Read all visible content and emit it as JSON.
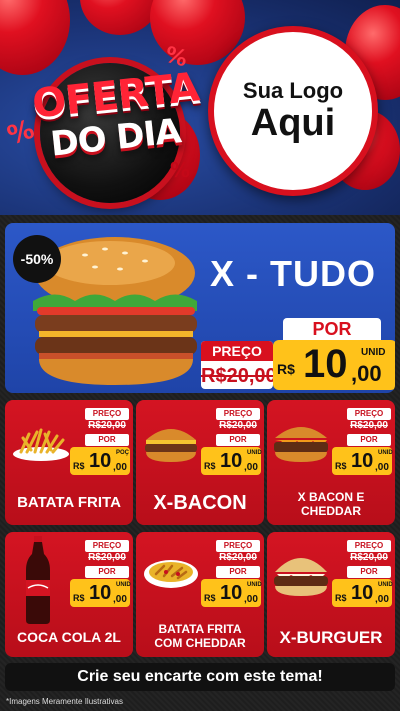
{
  "header": {
    "badge_line1": "OFERTA",
    "badge_line2": "DO DIA",
    "percent_symbol": "%",
    "logo_line1": "Sua Logo",
    "logo_line2": "Aqui"
  },
  "featured": {
    "discount": "-50%",
    "title": "X - TUDO",
    "old_label": "PREÇO",
    "old_price": "R$20,00",
    "new_label": "POR",
    "currency": "R$",
    "price_int": "10",
    "price_dec": ",00",
    "unit": "UNID"
  },
  "products": [
    {
      "name": "BATATA FRITA",
      "old_label": "PREÇO",
      "old_price": "R$20,00",
      "new_label": "POR",
      "currency": "R$",
      "price_int": "10",
      "price_dec": ",00",
      "unit": "POÇ",
      "icon": "fries-icon"
    },
    {
      "name": "X-BACON",
      "old_label": "PREÇO",
      "old_price": "R$20,00",
      "new_label": "POR",
      "currency": "R$",
      "price_int": "10",
      "price_dec": ",00",
      "unit": "UNID",
      "icon": "burger-icon"
    },
    {
      "name": "X BACON E CHEDDAR",
      "old_label": "PREÇO",
      "old_price": "R$20,00",
      "new_label": "POR",
      "currency": "R$",
      "price_int": "10",
      "price_dec": ",00",
      "unit": "UNID",
      "icon": "burger-icon"
    },
    {
      "name": "COCA COLA 2L",
      "old_label": "PREÇO",
      "old_price": "R$20,00",
      "new_label": "POR",
      "currency": "R$",
      "price_int": "10",
      "price_dec": ",00",
      "unit": "UNID",
      "icon": "soda-bottle-icon"
    },
    {
      "name": "BATATA FRITA COM CHEDDAR",
      "old_label": "PREÇO",
      "old_price": "R$20,00",
      "new_label": "POR",
      "currency": "R$",
      "price_int": "10",
      "price_dec": ",00",
      "unit": "UNID",
      "icon": "fries-cheddar-icon"
    },
    {
      "name": "X-BURGUER",
      "old_label": "PREÇO",
      "old_price": "R$20,00",
      "new_label": "POR",
      "currency": "R$",
      "price_int": "10",
      "price_dec": ",00",
      "unit": "UNID",
      "icon": "burger-icon"
    }
  ],
  "cta": "Crie seu encarte com este tema!",
  "footnote": "*Imagens Meramente Ilustrativas",
  "colors": {
    "red": "#d41422",
    "blue": "#2c58c8",
    "yellow": "#ffc21a",
    "dark": "#1a1a1a"
  }
}
